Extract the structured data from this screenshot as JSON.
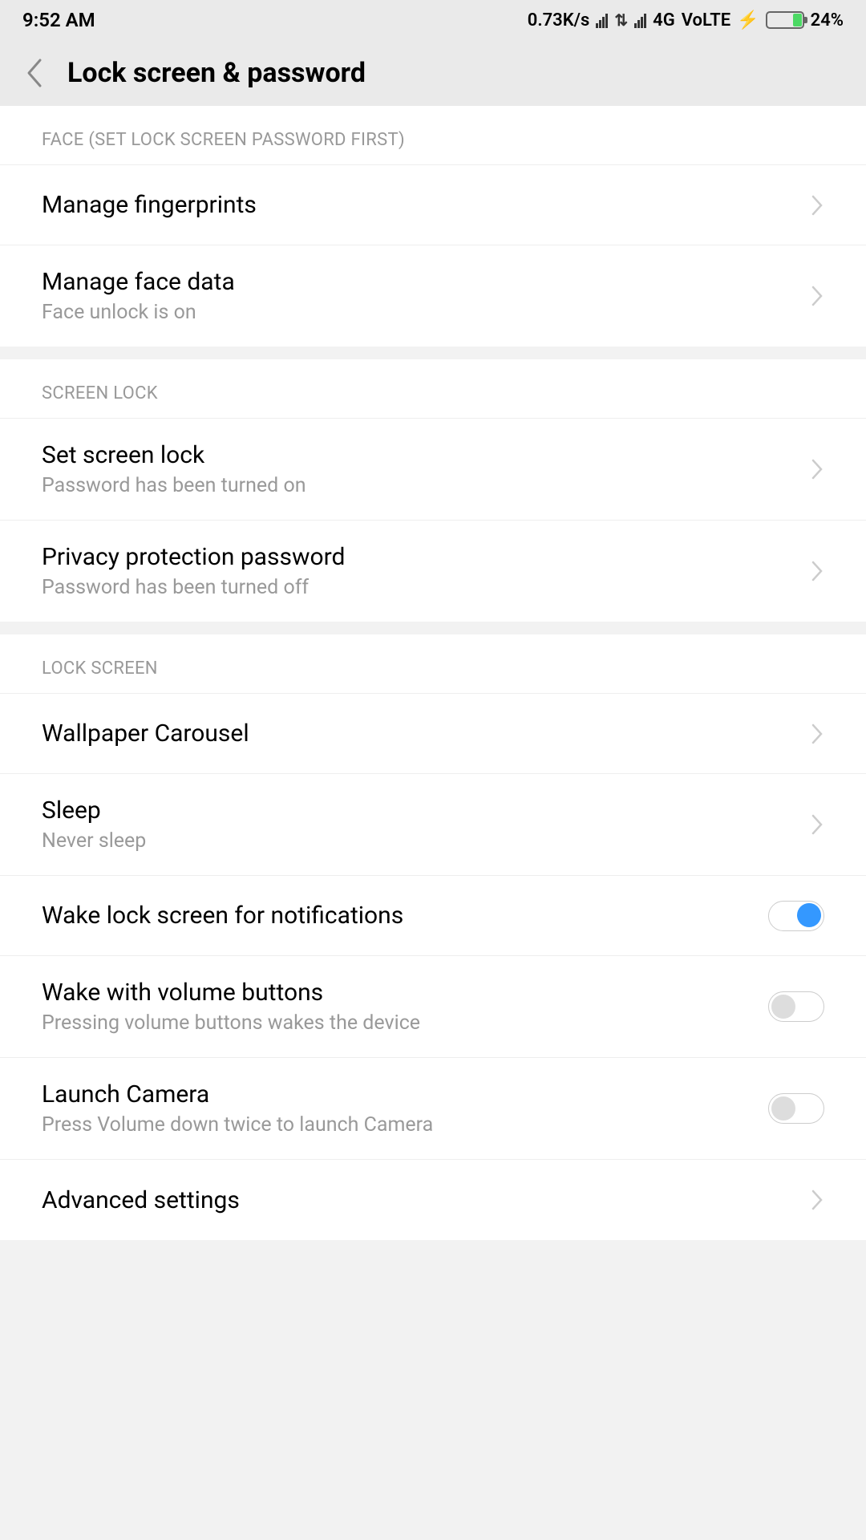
{
  "status": {
    "time": "9:52 AM",
    "data_rate": "0.73K/s",
    "network1": "4G",
    "network2": "VoLTE",
    "battery_pct": "24%",
    "charging_glyph": "⚡"
  },
  "header": {
    "title": "Lock screen & password"
  },
  "sections": {
    "face": {
      "header": "FACE (SET LOCK SCREEN PASSWORD FIRST)",
      "items": {
        "fingerprints": {
          "title": "Manage fingerprints"
        },
        "face_data": {
          "title": "Manage face data",
          "subtitle": "Face unlock is on"
        }
      }
    },
    "screen_lock": {
      "header": "SCREEN LOCK",
      "items": {
        "set_lock": {
          "title": "Set screen lock",
          "subtitle": "Password has been turned on"
        },
        "privacy": {
          "title": "Privacy protection password",
          "subtitle": "Password has been turned off"
        }
      }
    },
    "lock_screen": {
      "header": "LOCK SCREEN",
      "items": {
        "carousel": {
          "title": "Wallpaper Carousel"
        },
        "sleep": {
          "title": "Sleep",
          "subtitle": "Never sleep"
        },
        "wake_notif": {
          "title": "Wake lock screen for notifications",
          "toggle": true
        },
        "wake_volume": {
          "title": "Wake with volume buttons",
          "subtitle": "Pressing volume buttons wakes the device",
          "toggle": false
        },
        "camera": {
          "title": "Launch Camera",
          "subtitle": "Press Volume down twice to launch Camera",
          "toggle": false
        },
        "advanced": {
          "title": "Advanced settings"
        }
      }
    }
  }
}
